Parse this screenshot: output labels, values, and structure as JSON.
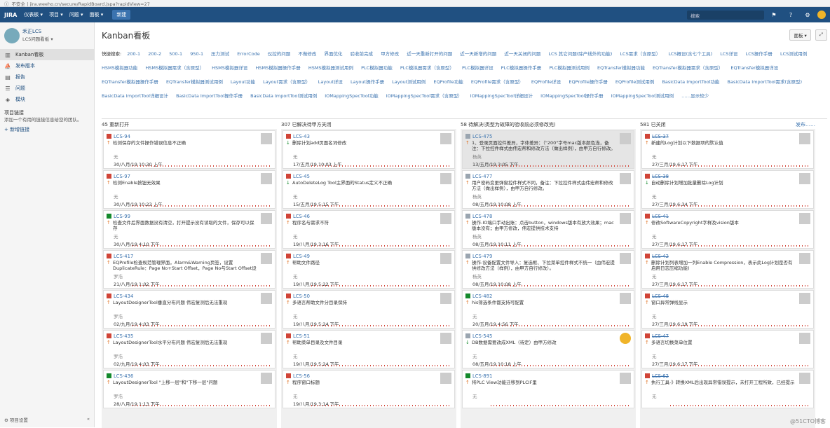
{
  "browser": {
    "url": "不安全 | jira.weeho.cn/secure/RapidBoard.jspa?rapidView=27"
  },
  "nav": {
    "logo": "JIRA",
    "items": [
      "仪表板 ▾",
      "项目 ▾",
      "问题 ▾",
      "面板 ▾"
    ],
    "create": "新建",
    "search": "搜索"
  },
  "sidebar": {
    "project_name": "禾正LCS",
    "project_sub": "LCS问题看板 ▾",
    "items": [
      "Kanban看板",
      "发布版本",
      "报告",
      "问题",
      "模块"
    ],
    "links_head": "项目链接",
    "links_text": "添加一个有用的链接信息给您的团队。",
    "add_link": "+ 新增链接",
    "settings": "项目设置",
    "collapse": "«"
  },
  "header": {
    "title": "Kanban看板",
    "board_btn": "面板 ▾",
    "expand": "⤢"
  },
  "filters": {
    "label": "快捷搜索:",
    "items": [
      "200-1",
      "200-2",
      "500-1",
      "950-1",
      "压力测试",
      "ErrorCode",
      "仪控的问题",
      "不做修改",
      "界面优化",
      "验收前完成",
      "甲方修改",
      "近一天重新打开的问题",
      "近一天新增的问题",
      "近一天关闭的问题",
      "LCS 其它问题(除产线外的功能)",
      "LCS需求（含原型）",
      "LCS概设(含七个工具)",
      "LCS详设",
      "LCS操作手册",
      "LCS测试用例",
      "HSMS模拟器功能",
      "HSMS模拟器需求（含原型）",
      "HSMS模拟器详设",
      "HSMS模拟器操作手册",
      "HSMS模拟器测试用例",
      "PLC模拟器功能",
      "PLC模拟器需求（含原型）",
      "PLC模拟器详设",
      "PLC模拟器操作手册",
      "PLC模拟器测试用例",
      "EQTransfer模拟器功能",
      "EQTransfer模拟器需求（含原型）",
      "EQTransfer模拟器详设",
      "EQTransfer模拟器操作手册",
      "EQTransfer模拟器测试用例",
      "Layout功能",
      "Layout需求（含原型）",
      "Layout详设",
      "Layout操作手册",
      "Layout测试用例",
      "EQProfile功能",
      "EQProfile需求（含原型）",
      "EQProfile详设",
      "EQProfile操作手册",
      "EQProfile测试用例",
      "BasicData ImportTool功能",
      "BasicData ImportTool需求(含原型)",
      "BasicData ImportTool详细设计",
      "BasicData ImportTool操作手册",
      "BasicData ImportTool测试用例",
      "IOMappingSpecTool功能",
      "IOMappingSpecTool需求（含原型）",
      "IOMappingSpecTool详细设计",
      "IOMappingSpecTool操作手册",
      "IOMappingSpecTool测试用例",
      "……显示较少"
    ]
  },
  "columns": [
    {
      "title": "45 重新打开",
      "extra": "",
      "cards": [
        {
          "type": "bug",
          "key": "LCS-94",
          "pri": "up",
          "sum": "检测保存的文件操作错误信息不正确",
          "who": "无",
          "date": "30/八月/19 10:30 上午"
        },
        {
          "type": "bug",
          "key": "LCS-97",
          "pri": "up",
          "sum": "检测Enable按钮无效果",
          "who": "无",
          "date": "30/八月/19 10:23 上午"
        },
        {
          "type": "imp",
          "key": "LCS-99",
          "pri": "up",
          "sum": "检查文件后界面数据没有清空，打开提示没有读取的文件，保存可以保存",
          "who": "无",
          "date": "30/八月/19 4:10 下午"
        },
        {
          "type": "bug",
          "key": "LCS-417",
          "pri": "up",
          "sum": "EQProfile检查规范管理界面，Alarm&Warning页签，设置DuplicateRule：Page No+Start Offset，Page No与Start Offset设置验证重复项。实际提示Page No重复项，Page No与Start",
          "who": "罗浩",
          "date": "21/八月/19 1:02 下午"
        },
        {
          "type": "bug",
          "key": "LCS-434",
          "pri": "up",
          "sum": "LayoutDesignerTool垂直分布问题 伟宏复测后无法重现",
          "who": "罗浩",
          "date": "02/九月/19 4:03 下午"
        },
        {
          "type": "bug",
          "key": "LCS-435",
          "pri": "up",
          "sum": "LayoutDesignerTool水平分布问题 伟宏复测后无法重现",
          "who": "罗浩",
          "date": "02/九月/19 4:03 下午"
        },
        {
          "type": "imp",
          "key": "LCS-436",
          "pri": "up",
          "sum": "LayoutDesignerTool \"上移一层\"和\"下移一层\"问题",
          "who": "罗浩",
          "date": "28/八月/19 1:13 下午"
        }
      ]
    },
    {
      "title": "307 已解决待甲方关闭",
      "extra": "",
      "cards": [
        {
          "type": "bug",
          "key": "LCS-43",
          "pri": "down",
          "sum": "删除计划add页面名词修改",
          "who": "无",
          "date": "17/五月/19 10:03 上午"
        },
        {
          "type": "bug",
          "key": "LCS-45",
          "pri": "down",
          "sum": "AutoDeleteLog Tool主界面的Status定义不正确",
          "who": "无",
          "date": "15/五月/19 5:15 下午"
        },
        {
          "type": "bug",
          "key": "LCS-46",
          "pri": "up",
          "sum": "程序名与需求不符",
          "who": "无",
          "date": "19/八月/19 3:16 下午"
        },
        {
          "type": "bug",
          "key": "LCS-49",
          "pri": "up",
          "sum": "帮助文件路径",
          "who": "无",
          "date": "19/八月/19 5:22 下午"
        },
        {
          "type": "bug",
          "key": "LCS-50",
          "pri": "up",
          "sum": "多语言帮助文件分目录保持",
          "who": "无",
          "date": "19/八月/19 5:24 下午"
        },
        {
          "type": "bug",
          "key": "LCS-51",
          "pri": "up",
          "sum": "帮助菜单目录及文件目录",
          "who": "无",
          "date": "19/八月/19 5:24 下午"
        },
        {
          "type": "bug",
          "key": "LCS-56",
          "pri": "up",
          "sum": "程序窗口标题",
          "who": "无",
          "date": "19/八月/19 3:14 下午"
        }
      ]
    },
    {
      "title": "58 待解决(类型为故障的验收前必须修改完)",
      "extra": "",
      "cards": [
        {
          "type": "task",
          "key": "LCS-475",
          "pri": "up",
          "sum": "1、登录页面控件差异，字体差异：（\"200\"字号mac版本颜色浅，备注：下拉控件样式由伟宏帮和修改方法（做出样例），由甲方自行修改。",
          "who": "杨英",
          "date": "13/五月/19 3:05 下午",
          "sel": true
        },
        {
          "type": "task",
          "key": "LCS-477",
          "pri": "up",
          "sum": "用户密码变更弹窗控件样式不同，备注：下拉控件样式由伟宏帮和修改方法（做出样例），由甲方自行修改。",
          "who": "杨英",
          "date": "08/五月/19 10:08 上午"
        },
        {
          "type": "task",
          "key": "LCS-478",
          "pri": "up",
          "sum": "操作-IO端口手动出账：点击button，windows版本有放大效果；mac版本没有；由甲方修改，伟宏提供技术支持",
          "who": "杨英",
          "date": "08/五月/19 10:11 上午"
        },
        {
          "type": "task",
          "key": "LCS-479",
          "pri": "up",
          "sum": "操作-设备配置文件导入：复选框、下拉菜单控件样式不统一（由伟宏提供修改方法（样例），由甲方自行修改）。",
          "who": "杨英",
          "date": "08/五月/19 10:08 上午"
        },
        {
          "type": "imp",
          "key": "LCS-482",
          "pri": "up",
          "sum": "his筛选条件都支持可配置",
          "who": "无",
          "date": "20/五月/19 4:56 下午"
        },
        {
          "type": "task",
          "key": "LCS-545",
          "pri": "down",
          "sum": "DB数据需要改成XML（待定）由甲方修改",
          "who": "无",
          "date": "08/五月/19 10:18 上午",
          "yel": true
        },
        {
          "type": "imp",
          "key": "LCS-891",
          "pri": "up",
          "sum": "将PLC View功能迁移到PLCIF里",
          "who": "无",
          "date": ""
        }
      ]
    },
    {
      "title": "581 已关闭",
      "extra": "发布……",
      "cards": [
        {
          "type": "bug",
          "key": "LCS-37",
          "pri": "up",
          "sum": "新建的Log计划以下数据项的默认值",
          "who": "无",
          "date": "27/三月/19 6:17 下午",
          "done": true
        },
        {
          "type": "bug",
          "key": "LCS-38",
          "pri": "down",
          "sum": "自动删除计划增加批量删除Log计划",
          "who": "无",
          "date": "27/三月/19 6:34 下午",
          "done": true
        },
        {
          "type": "bug",
          "key": "LCS-41",
          "pri": "up",
          "sum": "修改SoftwareCopyright字样及vision版本",
          "who": "无",
          "date": "27/三月/19 6:17 下午",
          "done": true
        },
        {
          "type": "bug",
          "key": "LCS-42",
          "pri": "up",
          "sum": "删除计划列表增加一列Enable Compression，表示此Log计划是否有启用日志压缩功能)",
          "who": "无",
          "date": "27/三月/19 6:17 下午",
          "done": true
        },
        {
          "type": "bug",
          "key": "LCS-48",
          "pri": "up",
          "sum": "窗口异常弹线显示",
          "who": "无",
          "date": "27/三月/19 6:19 下午",
          "done": true
        },
        {
          "type": "bug",
          "key": "LCS-47",
          "pri": "up",
          "sum": "多语言切换菜单位置",
          "who": "无",
          "date": "27/三月/19 6:17 下午",
          "done": true
        },
        {
          "type": "bug",
          "key": "LCS-62",
          "pri": "up",
          "sum": "执行工具-》转换XML后出现异常错误提示，未打开工程所致，已经提示",
          "who": "无",
          "date": "",
          "done": true
        }
      ]
    }
  ],
  "watermark": "@51CTO博客"
}
